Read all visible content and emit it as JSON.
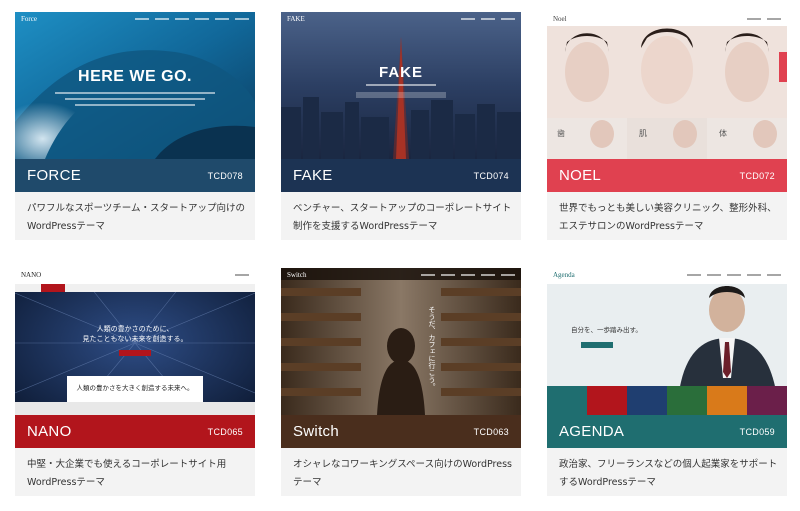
{
  "cards": [
    {
      "name": "FORCE",
      "code": "TCD078",
      "desc": [
        "パワフルなスポーツチーム・スタートアップ向けの",
        "WordPressテーマ"
      ],
      "bar_color": "#1f4a6b",
      "logo": "Force",
      "headline": "HERE WE GO."
    },
    {
      "name": "FAKE",
      "code": "TCD074",
      "desc": [
        "ベンチャー、スタートアップのコーポレートサイト",
        "制作を支援するWordPressテーマ"
      ],
      "bar_color": "#1c3353",
      "logo": "FAKE",
      "headline": "FAKE"
    },
    {
      "name": "NOEL",
      "code": "TCD072",
      "desc": [
        "世界でもっとも美しい美容クリニック、整形外科、",
        "エステサロンのWordPressテーマ"
      ],
      "bar_color": "#e04150",
      "logo": "Noel",
      "labels": [
        "歯",
        "肌",
        "体"
      ]
    },
    {
      "name": "NANO",
      "code": "TCD065",
      "desc": [
        "中堅・大企業でも使えるコーポレートサイト用",
        "WordPressテーマ"
      ],
      "bar_color": "#b2151c",
      "logo": "NANO",
      "headline": "人類の豊かさのために、",
      "subline": "見たこともない未来を創造する。",
      "banner": "人類の豊かさを大きく創造する未来へ。"
    },
    {
      "name": "Switch",
      "code": "TCD063",
      "desc": [
        "オシャレなコワーキングスペース向けのWordPress",
        "テーマ"
      ],
      "bar_color": "#4a2e1d",
      "logo": "Switch",
      "headline": "そうだ、カフェに行こう。"
    },
    {
      "name": "AGENDA",
      "code": "TCD059",
      "desc": [
        "政治家、フリーランスなどの個人起業家をサポート",
        "するWordPressテーマ"
      ],
      "bar_color": "#1f6e70",
      "logo": "Agenda",
      "headline": "自分を、一歩踏み出す。"
    }
  ]
}
